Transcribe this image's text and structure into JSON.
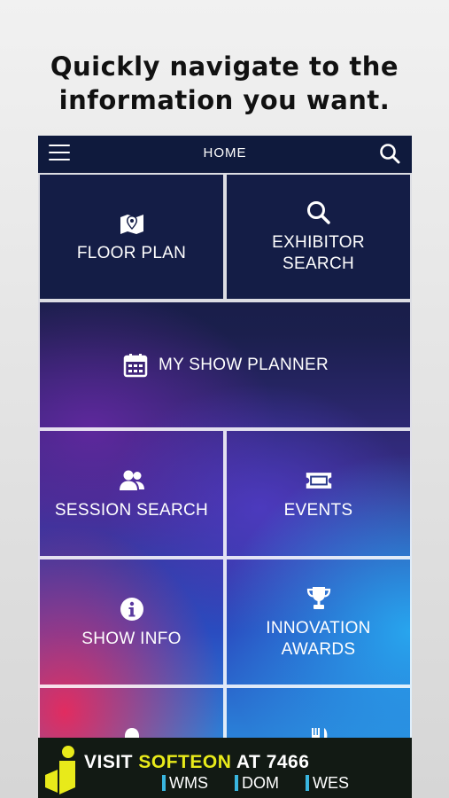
{
  "headline": {
    "line1": "Quickly navigate to the",
    "line2": "information you want."
  },
  "topbar": {
    "title": "HOME",
    "menu_icon": "hamburger-menu-icon",
    "search_icon": "search-icon"
  },
  "tiles": {
    "floor_plan": {
      "label": "FLOOR PLAN",
      "icon": "map-pin-icon"
    },
    "exhibitor_search": {
      "label": "EXHIBITOR\nSEARCH",
      "icon": "search-icon"
    },
    "my_show_planner": {
      "label": "MY SHOW PLANNER",
      "icon": "calendar-icon"
    },
    "session_search": {
      "label": "SESSION SEARCH",
      "icon": "people-icon"
    },
    "events": {
      "label": "EVENTS",
      "icon": "ticket-icon"
    },
    "show_info": {
      "label": "SHOW INFO",
      "icon": "info-icon"
    },
    "innovation_awards": {
      "label": "INNOVATION\nAWARDS",
      "icon": "trophy-icon"
    },
    "bottom_left": {
      "label": "",
      "icon": "bell-icon"
    },
    "bottom_right": {
      "label": "",
      "icon": "fork-knife-icon"
    }
  },
  "banner": {
    "visit": "VISIT ",
    "brand": "SOFTEON",
    "at": " AT 7466",
    "tags": [
      "WMS",
      "DOM",
      "WES"
    ],
    "logo_icon": "softeon-logo",
    "colors": {
      "brand": "#e8ea1a",
      "tag_bar": "#39b6e0"
    }
  }
}
